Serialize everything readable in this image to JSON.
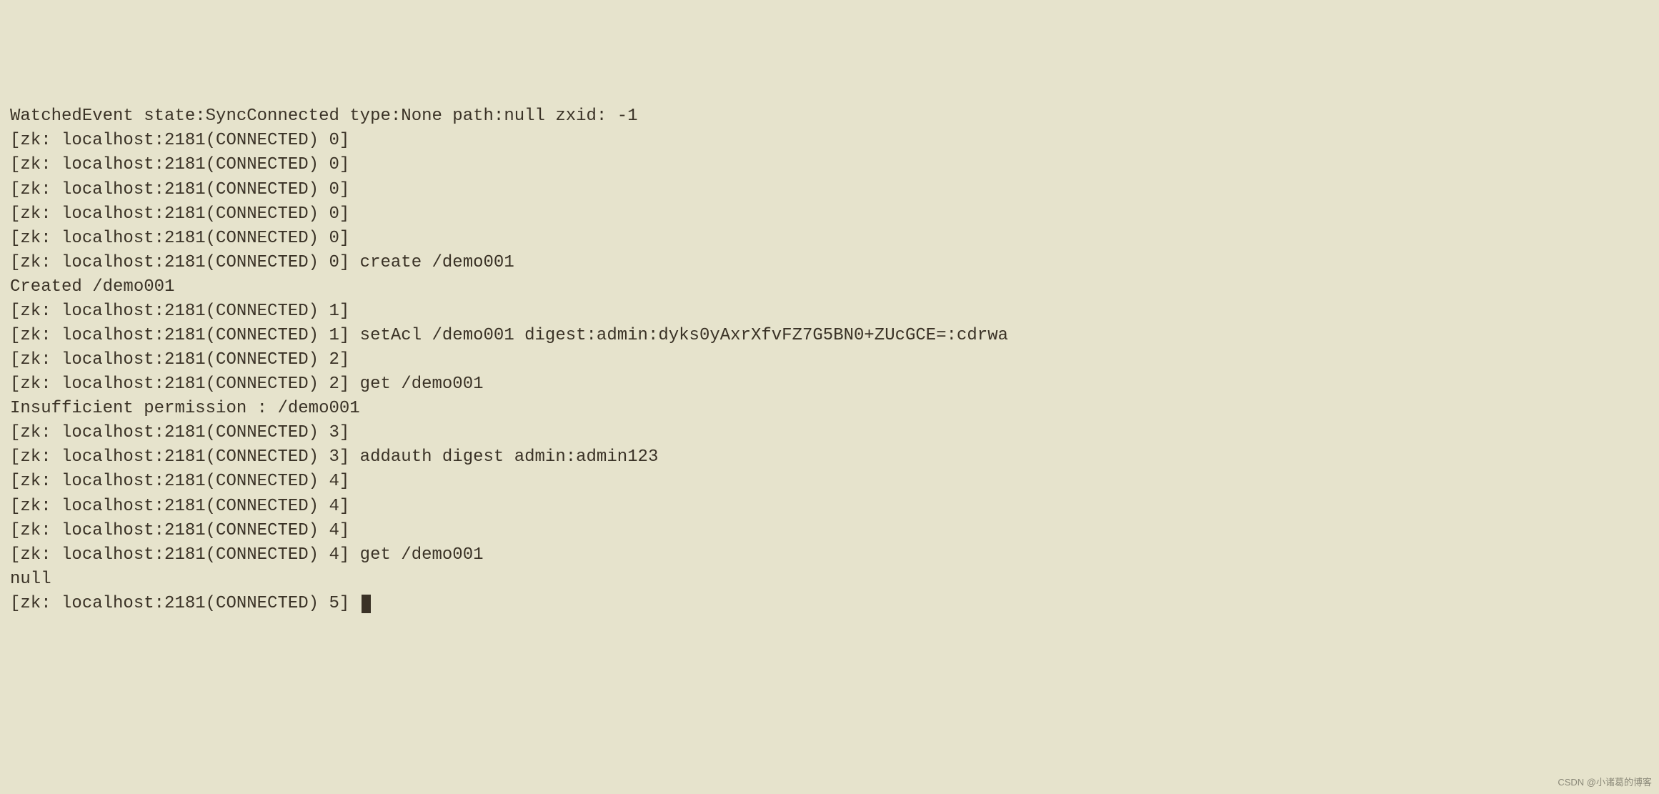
{
  "terminal": {
    "lines": [
      "WatchedEvent state:SyncConnected type:None path:null zxid: -1",
      "[zk: localhost:2181(CONNECTED) 0]",
      "[zk: localhost:2181(CONNECTED) 0]",
      "[zk: localhost:2181(CONNECTED) 0]",
      "[zk: localhost:2181(CONNECTED) 0]",
      "[zk: localhost:2181(CONNECTED) 0]",
      "[zk: localhost:2181(CONNECTED) 0] create /demo001",
      "Created /demo001",
      "[zk: localhost:2181(CONNECTED) 1]",
      "[zk: localhost:2181(CONNECTED) 1] setAcl /demo001 digest:admin:dyks0yAxrXfvFZ7G5BN0+ZUcGCE=:cdrwa",
      "[zk: localhost:2181(CONNECTED) 2]",
      "[zk: localhost:2181(CONNECTED) 2] get /demo001",
      "Insufficient permission : /demo001",
      "[zk: localhost:2181(CONNECTED) 3]",
      "[zk: localhost:2181(CONNECTED) 3] addauth digest admin:admin123",
      "[zk: localhost:2181(CONNECTED) 4]",
      "[zk: localhost:2181(CONNECTED) 4]",
      "[zk: localhost:2181(CONNECTED) 4]",
      "[zk: localhost:2181(CONNECTED) 4] get /demo001",
      "null"
    ],
    "current_prompt": "[zk: localhost:2181(CONNECTED) 5] "
  },
  "watermark": "CSDN @小诸葛的博客"
}
